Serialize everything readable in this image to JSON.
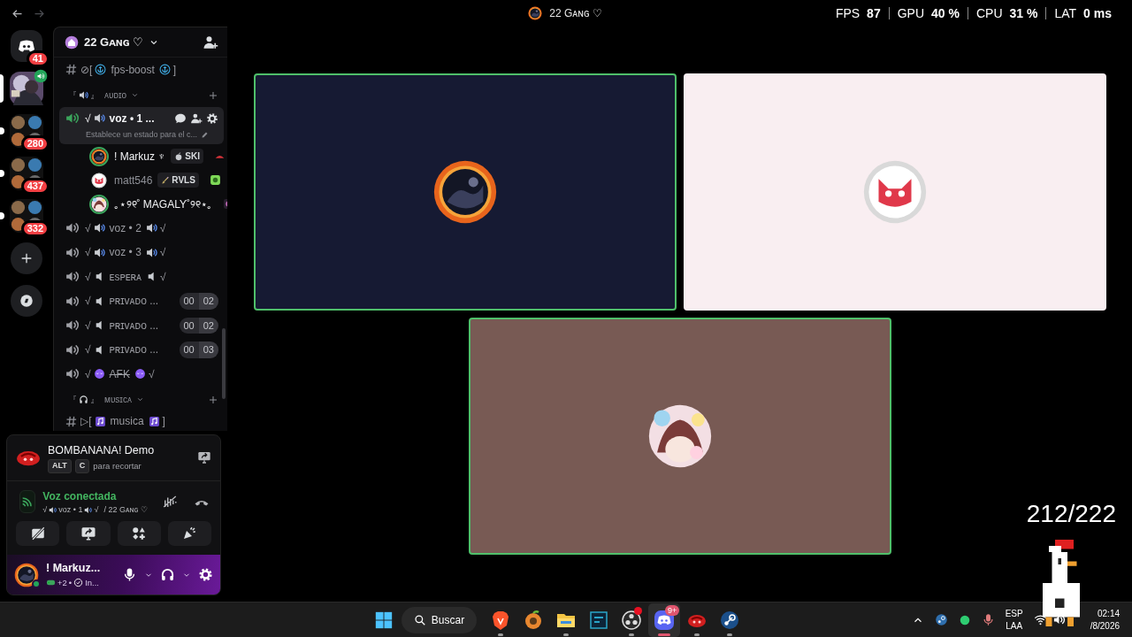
{
  "top_bar": {
    "server_title": "22 Gᴀɴɢ ♡",
    "stats": [
      {
        "label": "FPS",
        "value": "87"
      },
      {
        "label": "GPU",
        "value": "40 %"
      },
      {
        "label": "CPU",
        "value": "31 %"
      },
      {
        "label": "LAT",
        "value": "0 ms"
      }
    ]
  },
  "server_rail": [
    {
      "kind": "home",
      "badge": "41",
      "selected": false,
      "in_voice": false,
      "unread": false
    },
    {
      "kind": "server",
      "selected": true,
      "in_voice": true,
      "unread": false
    },
    {
      "kind": "folder",
      "badge": "280",
      "selected": false,
      "in_voice": false,
      "unread": true
    },
    {
      "kind": "folder",
      "badge": "437",
      "selected": false,
      "in_voice": false,
      "unread": true
    },
    {
      "kind": "folder",
      "badge": "332",
      "selected": false,
      "in_voice": false,
      "unread": true
    },
    {
      "kind": "add",
      "selected": false,
      "in_voice": false,
      "unread": false
    },
    {
      "kind": "explore",
      "selected": false,
      "in_voice": false,
      "unread": false
    }
  ],
  "sidebar": {
    "title": "22 Gᴀɴɢ ♡",
    "channels": [
      {
        "kind": "text",
        "prefix": "⊘[",
        "name": "fps-boost",
        "suffix": "]"
      },
      {
        "kind": "category",
        "left_mark": "『",
        "right_mark": "』",
        "name": "ᴀᴜᴅɪᴏ",
        "expanded": true
      },
      {
        "kind": "voice",
        "prefix": "√",
        "name": "voz • 1 ...",
        "connected": true,
        "struck": false,
        "status": "Establece un estado para el c...",
        "members": [
          {
            "name": "! Markuz ♆",
            "speaking": true,
            "idle": false,
            "tag": "SKI"
          },
          {
            "name": "matt546",
            "speaking": false,
            "idle": true,
            "tag": "RVLS"
          },
          {
            "name": "｡⋆୨୧˚ MAGALY˚୨୧⋆｡",
            "speaking": true,
            "idle": false
          }
        ]
      },
      {
        "kind": "voice",
        "prefix": "√",
        "name": "voz • 2",
        "suffix": "√",
        "connected": false,
        "struck": false
      },
      {
        "kind": "voice",
        "prefix": "√",
        "name": "voz • 3",
        "suffix": "√",
        "connected": false,
        "struck": false
      },
      {
        "kind": "voice",
        "prefix": "√",
        "name": "ᴇsᴘᴇʀᴀ",
        "suffix": "√",
        "connected": false,
        "struck": false
      },
      {
        "kind": "voice",
        "prefix": "√",
        "name": "ᴘʀɪᴠᴀᴅᴏ ...",
        "connected": false,
        "struck": false,
        "count": "00",
        "limit": "02"
      },
      {
        "kind": "voice",
        "prefix": "√",
        "name": "ᴘʀɪᴠᴀᴅᴏ ...",
        "connected": false,
        "struck": false,
        "count": "00",
        "limit": "02"
      },
      {
        "kind": "voice",
        "prefix": "√",
        "name": "ᴘʀɪᴠᴀᴅᴏ ...",
        "connected": false,
        "struck": false,
        "count": "00",
        "limit": "03"
      },
      {
        "kind": "voice",
        "prefix": "√",
        "name": "AFK",
        "suffix": "√",
        "connected": false,
        "struck": true
      },
      {
        "kind": "category",
        "left_mark": "『",
        "right_mark": "』",
        "name": "ᴍᴜsɪᴄᴀ",
        "expanded": true
      },
      {
        "kind": "text",
        "prefix": "▷[",
        "name": "musica",
        "suffix": "]"
      }
    ]
  },
  "activity": {
    "title": "BOMBANANA! Demo",
    "keys": [
      "ALT",
      "C"
    ],
    "hint": "para recortar"
  },
  "voice_status": {
    "status": "Voz conectada",
    "prefix": "√",
    "channel": "voz • 1",
    "suffix": "√",
    "server": "/ 22 Gᴀɴɢ ♡"
  },
  "user": {
    "name": "! Markuz...",
    "activity": "+2",
    "separator": "•",
    "status": "In..."
  },
  "call": {
    "tiles": [
      {
        "speaking": true,
        "color": "#161a33"
      },
      {
        "speaking": false,
        "color": "#f9eef1"
      },
      {
        "speaking": true,
        "color": "#785a54"
      }
    ]
  },
  "overlay_counter": "212/222",
  "taskbar": {
    "search": "Buscar",
    "apps": [
      {
        "kind": "brave",
        "running": true,
        "active": false,
        "alert": false
      },
      {
        "kind": "fl",
        "running": false,
        "active": false,
        "alert": false
      },
      {
        "kind": "folder",
        "running": true,
        "active": false,
        "alert": false
      },
      {
        "kind": "vs",
        "running": false,
        "active": false,
        "alert": false
      },
      {
        "kind": "obs",
        "running": true,
        "active": false,
        "alert": true
      },
      {
        "kind": "discord",
        "running": true,
        "active": true,
        "alert": false,
        "badge": "9+"
      },
      {
        "kind": "game",
        "running": true,
        "active": false,
        "alert": false
      },
      {
        "kind": "steam",
        "running": true,
        "active": false,
        "alert": false
      }
    ],
    "language": [
      "ESP",
      "LAA"
    ],
    "time": "02:14",
    "date": "/8/2026"
  }
}
